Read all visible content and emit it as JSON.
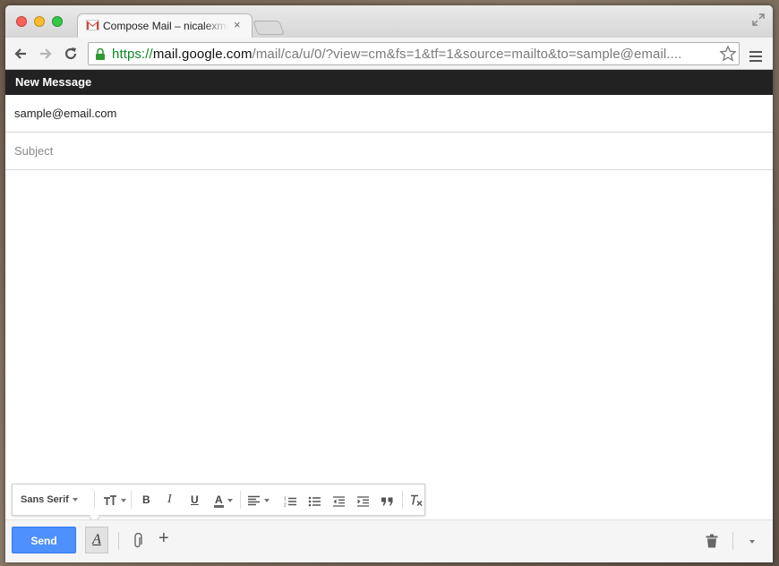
{
  "browser": {
    "tab_title": "Compose Mail – nicalexmi",
    "tab_close": "×",
    "url_scheme": "https://",
    "url_host": "mail.google.com",
    "url_path": "/mail/ca/u/0/?view=cm&fs=1&tf=1&source=mailto&to=sample@email...."
  },
  "compose": {
    "header_title": "New Message",
    "to_value": "sample@email.com",
    "subject_placeholder": "Subject",
    "body_value": ""
  },
  "formatting": {
    "font_label": "Sans Serif",
    "size_icon": "text-size-icon",
    "bold": "B",
    "italic": "I",
    "underline": "U",
    "text_color": "A"
  },
  "bottom": {
    "send_label": "Send",
    "format_toggle_label": "A",
    "add_label": "+"
  },
  "colors": {
    "send_blue": "#4d90fe",
    "header_bg": "#222222",
    "url_scheme_green": "#0b8a2a"
  }
}
